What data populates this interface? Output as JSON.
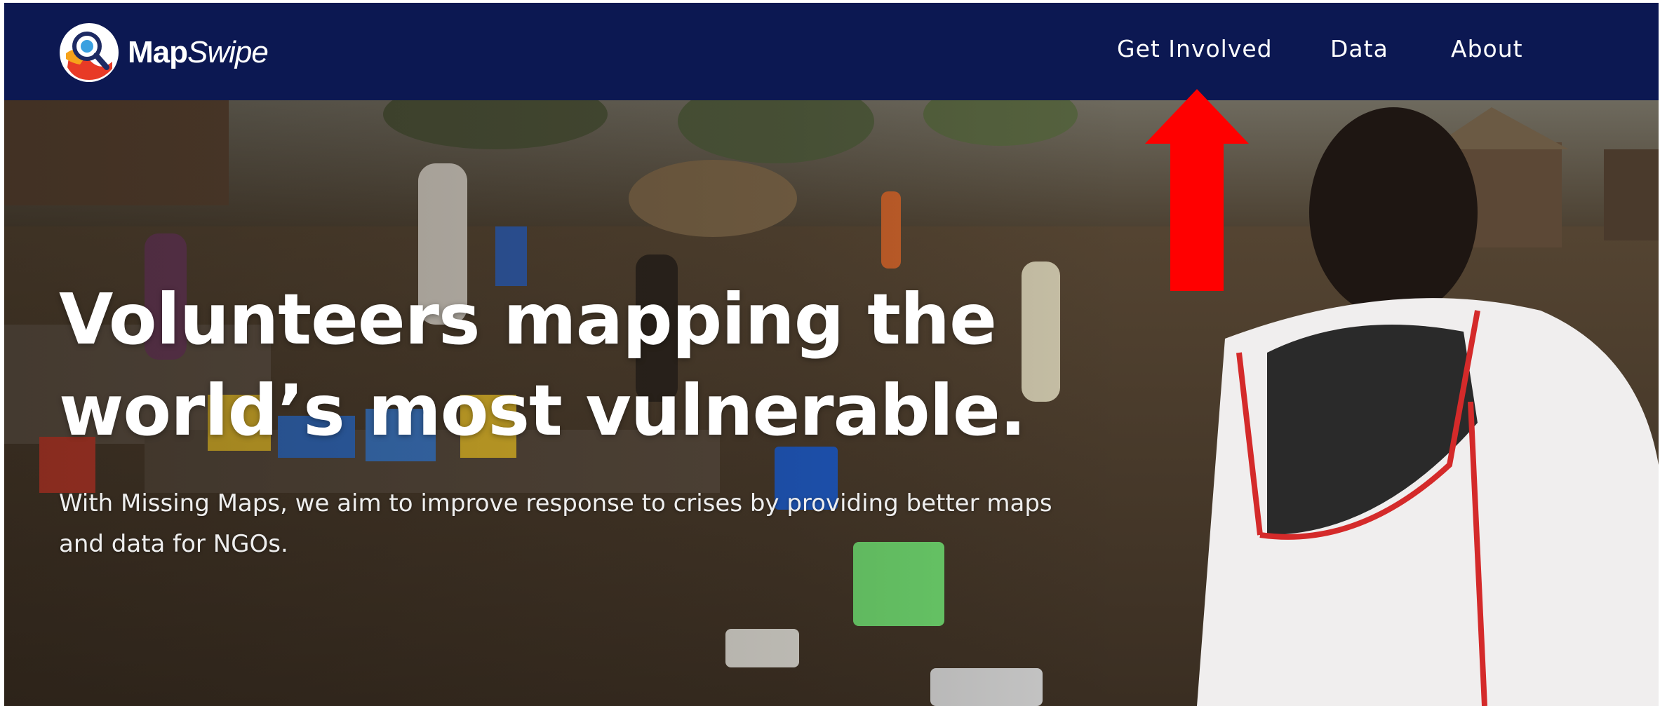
{
  "navbar": {
    "logo": {
      "text_bold": "Map",
      "text_italic": "Swipe"
    },
    "links": [
      {
        "label": "Get Involved"
      },
      {
        "label": "Data"
      },
      {
        "label": "About"
      }
    ]
  },
  "hero": {
    "headline_line1": "Volunteers mapping the",
    "headline_line2": "world’s most vulnerable.",
    "subtext_line1": "With Missing Maps, we aim to improve response to crises by providing better maps",
    "subtext_line2": "and data for NGOs."
  },
  "colors": {
    "navbar_bg": "#0c1852",
    "annotation_arrow": "#ff0000",
    "text": "#ffffff"
  },
  "icons": {
    "logo": "mapswipe-logo-icon",
    "annotation": "red-arrow-up-icon"
  }
}
